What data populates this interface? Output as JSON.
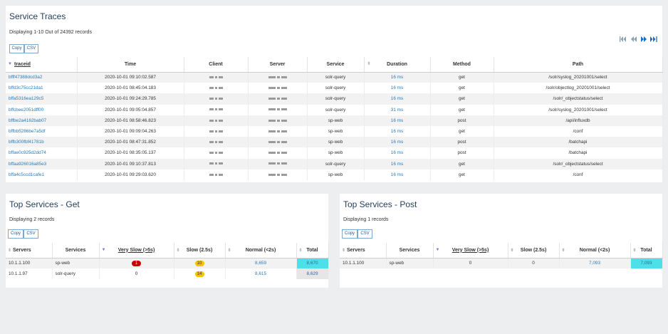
{
  "traces": {
    "title": "Service Traces",
    "subtitle": "Displaying 1-10 Out of 24392 records",
    "copy_label": "Copy",
    "csv_label": "CSV",
    "columns": [
      "traceid",
      "Time",
      "Client",
      "Server",
      "Service",
      "Duration",
      "Method",
      "Path"
    ],
    "rows": [
      [
        "bfff47388dcd3a2",
        "2020-10-01 09:10:02.587",
        "solr-query",
        "16 ms",
        "get",
        "/solr/syslog_20201001/select"
      ],
      [
        "bffd3c75cc21da1",
        "2020-10-01 08:45:04.183",
        "solr-query",
        "16 ms",
        "get",
        "/solr/objectlog_20201001/select"
      ],
      [
        "bffa5316ea129c5",
        "2020-10-01 09:24:29.785",
        "solr-query",
        "16 ms",
        "get",
        "/solr/_objectstatus/select"
      ],
      [
        "bffcbee2051dff00",
        "2020-10-01 09:05:04.857",
        "solr-query",
        "31 ms",
        "get",
        "/solr/syslog_20201001/select"
      ],
      [
        "bffbe2a4162bab07",
        "2020-10-01 08:58:46.823",
        "sp-web",
        "16 ms",
        "post",
        "/api/influxdb"
      ],
      [
        "bffbb5286be7a5df",
        "2020-10-01 09:09:04.263",
        "sp-web",
        "16 ms",
        "get",
        "/conf"
      ],
      [
        "bffb300fbf41781b",
        "2020-10-01 08:47:31.852",
        "sp-web",
        "16 ms",
        "post",
        "/batchapi"
      ],
      [
        "bffae0c925d2dd74",
        "2020-10-01 08:35:05.137",
        "sp-web",
        "16 ms",
        "post",
        "/batchapi"
      ],
      [
        "bffaa926016a85e3",
        "2020-10-01 09:10:37.813",
        "solr-query",
        "16 ms",
        "get",
        "/solr/_objectstatus/select"
      ],
      [
        "bffa4c5ccd1cafe1",
        "2020-10-01 09:29:03.620",
        "sp-web",
        "16 ms",
        "get",
        "/conf"
      ]
    ]
  },
  "top_get": {
    "title": "Top Services - Get",
    "subtitle": "Displaying 2 records",
    "copy_label": "Copy",
    "csv_label": "CSV",
    "columns": [
      "Servers",
      "Services",
      "Very Slow (>5s)",
      "Slow (2.5s)",
      "Normal (<2s)",
      "Total"
    ],
    "rows": [
      [
        "10.1.1.100",
        "sp-web",
        "1",
        "10",
        "8,659",
        "8,670"
      ],
      [
        "10.1.1.97",
        "solr-query",
        "0",
        "14",
        "8,615",
        "8,629"
      ]
    ]
  },
  "top_post": {
    "title": "Top Services - Post",
    "subtitle": "Displaying 1 records",
    "copy_label": "Copy",
    "csv_label": "CSV",
    "columns": [
      "Servers",
      "Services",
      "Very Slow (>5s)",
      "Slow (2.5s)",
      "Normal (<2s)",
      "Total"
    ],
    "rows": [
      [
        "10.1.1.100",
        "sp-web",
        "0",
        "0",
        "7,093",
        "7,093"
      ]
    ]
  },
  "colors": {
    "title": "#1f3c5a",
    "link": "#2a7ab8",
    "total_highlight": "#4de0e8",
    "badge_red": "#cc0000",
    "badge_yellow": "#f5c400"
  },
  "icons": [
    "sort-desc-icon",
    "first-page-icon",
    "prev-page-icon",
    "next-page-icon",
    "last-page-icon",
    "redacted-ip-icon"
  ]
}
